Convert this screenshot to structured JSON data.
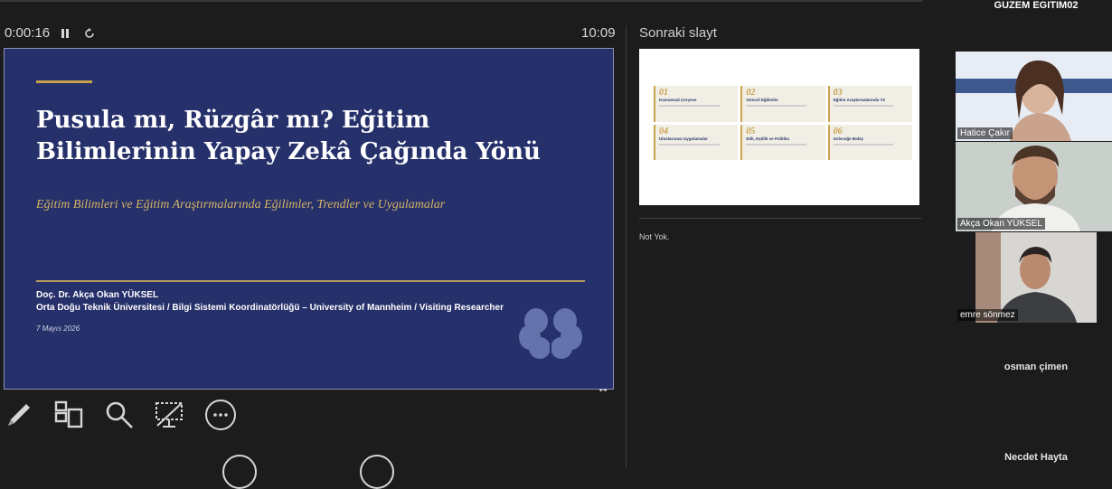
{
  "toolbar": {
    "elapsed_time": "0:00:16",
    "pause_icon": "pause-icon",
    "restart_icon": "restart-icon",
    "clock": "10:09"
  },
  "current_slide": {
    "title_line1": "Pusula mı, Rüzgâr mı? Eğitim",
    "title_line2": "Bilimlerinin Yapay Zekâ Çağında Yönü",
    "subtitle": "Eğitim Bilimleri ve Eğitim Araştırmalarında Eğilimler, Trendler ve Uygulamalar",
    "author": "Doç. Dr. Akça Okan YÜKSEL",
    "affiliation": "Orta Doğu Teknik Üniversitesi / Bilgi Sistemi Koordinatörlüğü – University of Mannheim / Visiting Researcher",
    "date": "7 Mayıs 2026",
    "accent_color": "#c8a24a",
    "background_color": "#26306a"
  },
  "presenter_tools": [
    {
      "name": "pen-tool",
      "icon": "pen-icon"
    },
    {
      "name": "slides-overview",
      "icon": "slides-grid-icon"
    },
    {
      "name": "zoom-tool",
      "icon": "magnifier-icon"
    },
    {
      "name": "black-screen-tool",
      "icon": "screen-off-icon"
    },
    {
      "name": "more-options",
      "icon": "more-dots-icon"
    }
  ],
  "next_slide": {
    "label": "Sonraki slayt",
    "cards": [
      {
        "num": "01",
        "title": "Kavramsal Çerçeve"
      },
      {
        "num": "02",
        "title": "Güncel Eğilimler"
      },
      {
        "num": "03",
        "title": "Eğitim Araştırmalarında YZ"
      },
      {
        "num": "04",
        "title": "Uluslararası Uygulamalar"
      },
      {
        "num": "05",
        "title": "Etik, Eşitlik ve Politika"
      },
      {
        "num": "06",
        "title": "Geleceğe Bakış"
      }
    ]
  },
  "notes": {
    "text": "Not Yok."
  },
  "participants": {
    "host": "GUZEM EGITIM02",
    "tiles": [
      {
        "name": "Hatice Çakır"
      },
      {
        "name": "Akça Okan YÜKSEL"
      },
      {
        "name": "emre sönmez"
      }
    ],
    "audio_only": [
      "osman çimen",
      "Necdet Hayta"
    ]
  }
}
